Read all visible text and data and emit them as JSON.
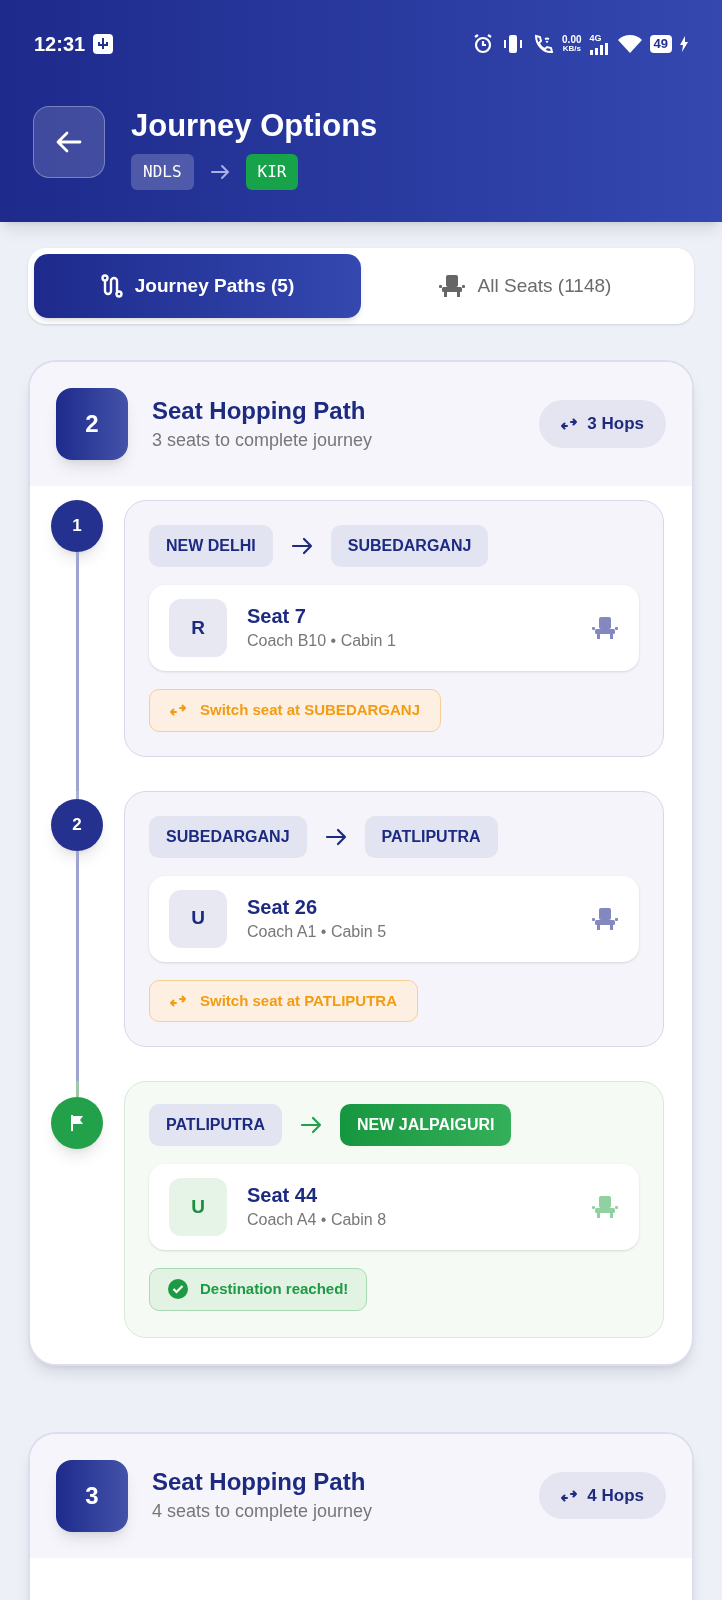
{
  "status_bar": {
    "time": "12:31",
    "net_speed": "0.00",
    "net_unit": "KB/s",
    "network": "4G",
    "battery": "49"
  },
  "header": {
    "title": "Journey Options",
    "from_code": "NDLS",
    "to_code": "KIR"
  },
  "tabs": [
    {
      "label": "Journey Paths (5)",
      "selected": true,
      "kind": "paths"
    },
    {
      "label": "All Seats (1148)",
      "selected": false,
      "kind": "seats"
    }
  ],
  "paths": [
    {
      "number": "2",
      "title": "Seat Hopping Path",
      "subtitle": "3 seats to complete journey",
      "hops": "3 Hops",
      "segments": [
        {
          "kind": "hop",
          "step": "1",
          "from": "NEW DELHI",
          "to": "SUBEDARGANJ",
          "berth": "R",
          "seat": "Seat 7",
          "details": "Coach B10 • Cabin 1",
          "note": "Switch seat at SUBEDARGANJ"
        },
        {
          "kind": "hop",
          "step": "2",
          "from": "SUBEDARGANJ",
          "to": "PATLIPUTRA",
          "berth": "U",
          "seat": "Seat 26",
          "details": "Coach A1 • Cabin 5",
          "note": "Switch seat at PATLIPUTRA"
        },
        {
          "kind": "final",
          "from": "PATLIPUTRA",
          "to": "NEW JALPAIGURI",
          "berth": "U",
          "seat": "Seat 44",
          "details": "Coach A4 • Cabin 8",
          "note": "Destination reached!"
        }
      ]
    },
    {
      "number": "3",
      "title": "Seat Hopping Path",
      "subtitle": "4 seats to complete journey",
      "hops": "4 Hops"
    }
  ]
}
